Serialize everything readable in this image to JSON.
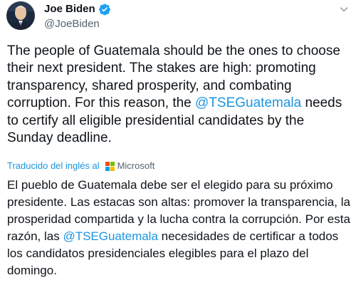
{
  "author": {
    "display_name": "Joe Biden",
    "handle": "@JoeBiden",
    "verified": true,
    "avatar_icon": "portrait-avatar"
  },
  "tweet": {
    "text_part1": "The people of Guatemala should be the ones to choose their next president. The stakes are high: promoting transparency, shared prosperity, and combating corruption. For this reason, the ",
    "mention": "@TSEGuatemala",
    "text_part2": " needs to certify all eligible presidential candidates by the Sunday deadline."
  },
  "translation": {
    "label": "Traducido del inglés al",
    "provider": "Microsoft",
    "text_part1": "El pueblo de Guatemala debe ser el elegido para su próximo presidente. Las estacas son altas: promover la transparencia, la prosperidad compartida y la lucha contra la corrupción. Por esta razón, las ",
    "mention": "@TSEGuatemala",
    "text_part2": " necesidades de certificar a todos los candidatos presidenciales elegibles para el plazo del domingo."
  },
  "colors": {
    "link": "#1b95e0",
    "secondary_text": "#536471",
    "primary_text": "#0f1419",
    "verified_badge": "#1da1f2",
    "ms_red": "#f25022",
    "ms_green": "#7fba00",
    "ms_blue": "#00a4ef",
    "ms_yellow": "#ffb900"
  },
  "icons": {
    "verified": "verified-badge-icon",
    "menu": "chevron-down-icon",
    "microsoft": "microsoft-logo-icon"
  }
}
